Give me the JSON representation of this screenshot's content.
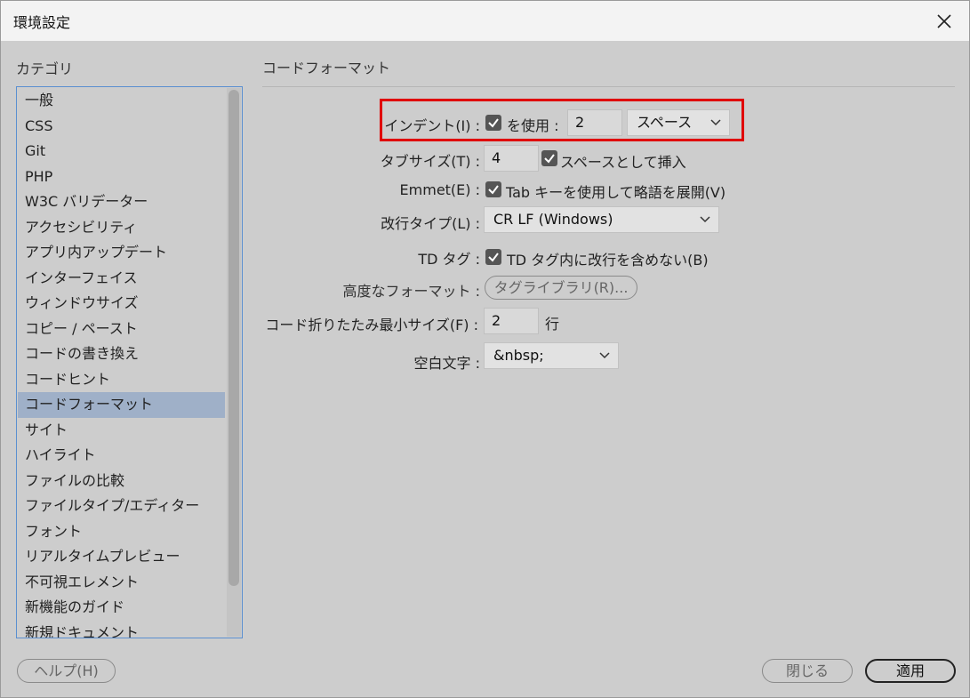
{
  "window": {
    "title": "環境設定"
  },
  "category": {
    "label": "カテゴリ",
    "items": [
      "一般",
      "CSS",
      "Git",
      "PHP",
      "W3C バリデーター",
      "アクセシビリティ",
      "アプリ内アップデート",
      "インターフェイス",
      "ウィンドウサイズ",
      "コピー / ペースト",
      "コードの書き換え",
      "コードヒント",
      "コードフォーマット",
      "サイト",
      "ハイライト",
      "ファイルの比較",
      "ファイルタイプ/エディター",
      "フォント",
      "リアルタイムプレビュー",
      "不可視エレメント",
      "新機能のガイド",
      "新規ドキュメント"
    ],
    "selected": "コードフォーマット"
  },
  "section": {
    "title": "コードフォーマット"
  },
  "settings": {
    "indent": {
      "label": "インデント(I) :",
      "use_label": "を使用 :",
      "value": "2",
      "unit": "スペース",
      "checked": true
    },
    "tab_size": {
      "label": "タブサイズ(T) :",
      "value": "4",
      "check_label": "スペースとして挿入",
      "checked": true
    },
    "emmet": {
      "label": "Emmet(E) :",
      "check_label": "Tab キーを使用して略語を展開(V)",
      "checked": true
    },
    "line_break": {
      "label": "改行タイプ(L) :",
      "value": "CR LF (Windows)"
    },
    "td_tag": {
      "label": "TD タグ :",
      "check_label": "TD タグ内に改行を含めない(B)",
      "checked": true
    },
    "advanced": {
      "label": "高度なフォーマット :",
      "button": "タグライブラリ(R)..."
    },
    "fold": {
      "label": "コード折りたたみ最小サイズ(F) :",
      "value": "2",
      "unit": "行"
    },
    "whitespace": {
      "label": "空白文字 :",
      "value": "&nbsp;"
    }
  },
  "footer": {
    "help": "ヘルプ(H)",
    "close": "閉じる",
    "apply": "適用"
  },
  "colors": {
    "highlight": "#e00000",
    "selected_row": "#9fb0c8",
    "focus_border": "#5a8fd0"
  }
}
